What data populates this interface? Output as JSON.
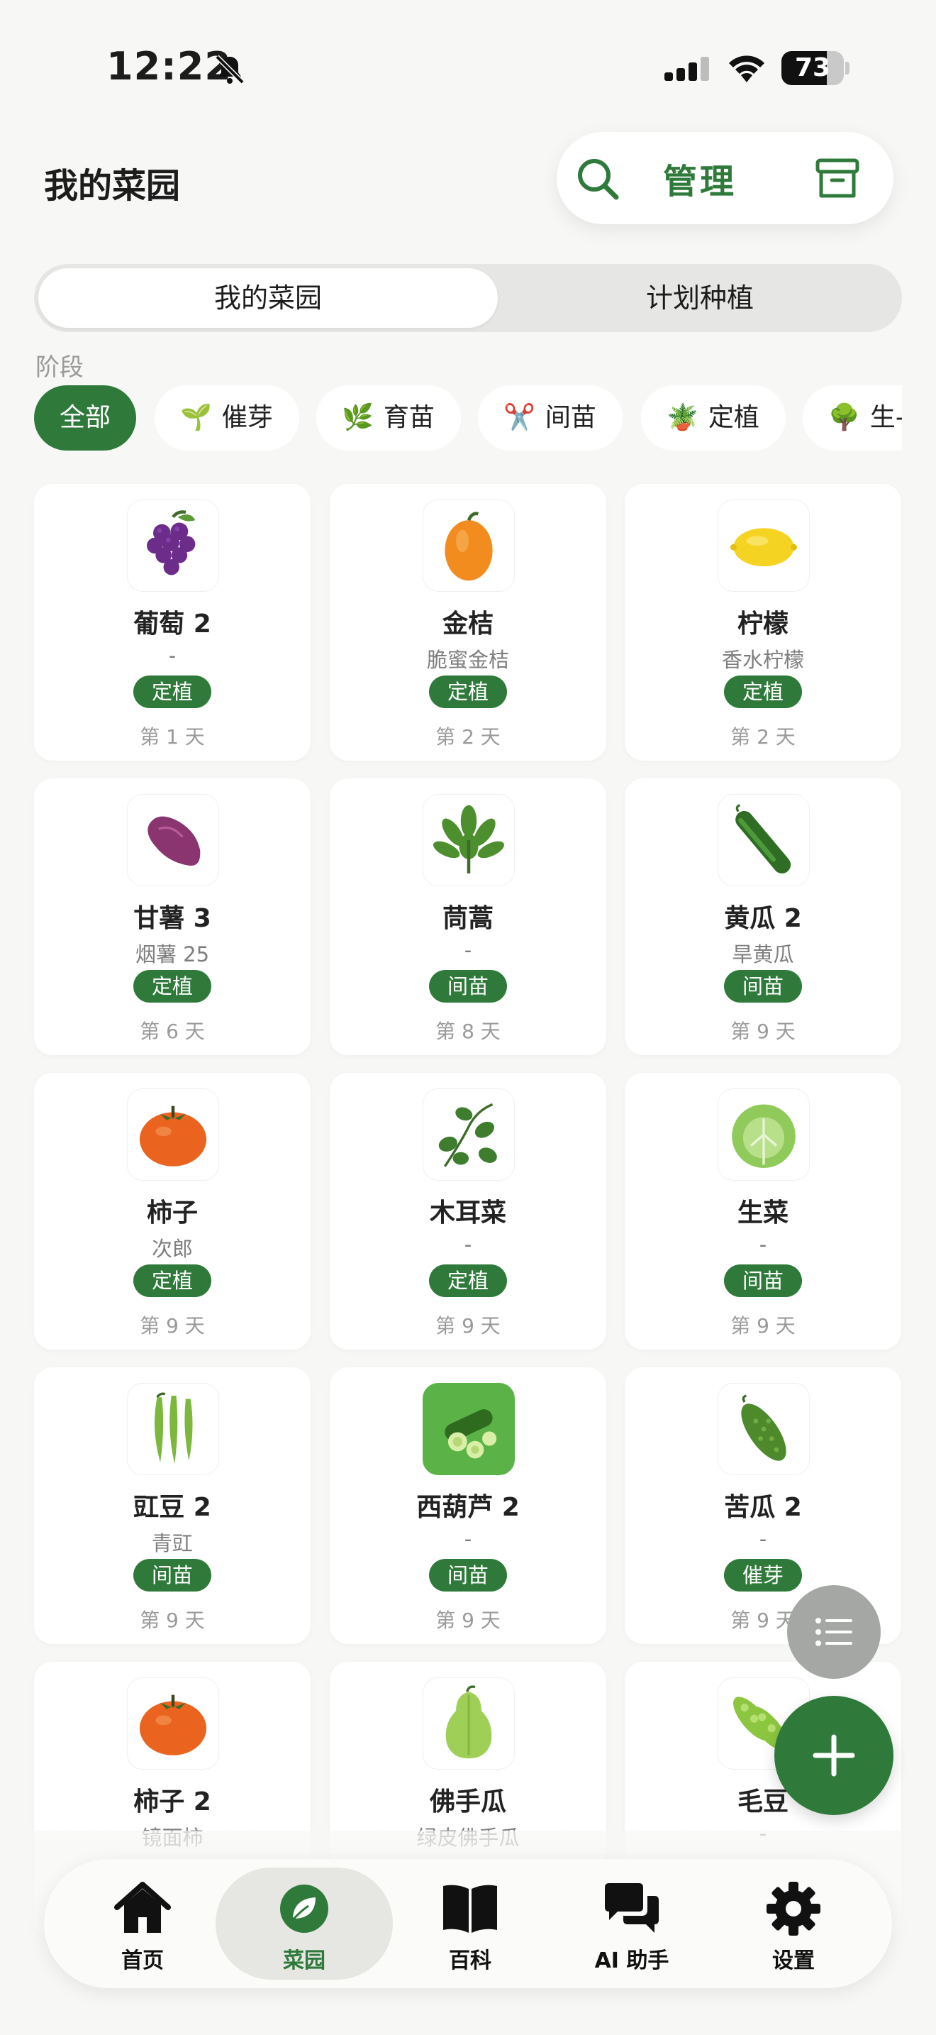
{
  "status": {
    "time": "12:22",
    "battery": "73",
    "battery_level": 0.73
  },
  "header": {
    "title": "我的菜园",
    "manage_label": "管理"
  },
  "segments": [
    {
      "label": "我的菜园"
    },
    {
      "label": "计划种植"
    }
  ],
  "stage_label": "阶段",
  "chips": [
    {
      "label": "全部",
      "icon": ""
    },
    {
      "label": "催芽",
      "icon": "🌱"
    },
    {
      "label": "育苗",
      "icon": "🌿"
    },
    {
      "label": "间苗",
      "icon": "✂️"
    },
    {
      "label": "定植",
      "icon": "🪴"
    },
    {
      "label": "生-",
      "icon": "🌳"
    }
  ],
  "plants": [
    {
      "name": "葡萄 2",
      "variety": "-",
      "stage": "定植",
      "days": "第 1 天",
      "icon": "grape-icon"
    },
    {
      "name": "金桔",
      "variety": "脆蜜金桔",
      "stage": "定植",
      "days": "第 2 天",
      "icon": "kumquat-icon"
    },
    {
      "name": "柠檬",
      "variety": "香水柠檬",
      "stage": "定植",
      "days": "第 2 天",
      "icon": "lemon-icon"
    },
    {
      "name": "甘薯 3",
      "variety": "烟薯 25",
      "stage": "定植",
      "days": "第 6 天",
      "icon": "sweet-potato-icon"
    },
    {
      "name": "茼蒿",
      "variety": "-",
      "stage": "间苗",
      "days": "第 8 天",
      "icon": "crown-daisy-icon"
    },
    {
      "name": "黄瓜 2",
      "variety": "旱黄瓜",
      "stage": "间苗",
      "days": "第 9 天",
      "icon": "cucumber-icon"
    },
    {
      "name": "柿子",
      "variety": "次郎",
      "stage": "定植",
      "days": "第 9 天",
      "icon": "persimmon-icon"
    },
    {
      "name": "木耳菜",
      "variety": "-",
      "stage": "定植",
      "days": "第 9 天",
      "icon": "malabar-spinach-icon"
    },
    {
      "name": "生菜",
      "variety": "-",
      "stage": "间苗",
      "days": "第 9 天",
      "icon": "lettuce-icon"
    },
    {
      "name": "豇豆 2",
      "variety": "青豇",
      "stage": "间苗",
      "days": "第 9 天",
      "icon": "cowpea-icon"
    },
    {
      "name": "西葫芦 2",
      "variety": "-",
      "stage": "间苗",
      "days": "第 9 天",
      "icon": "zucchini-icon"
    },
    {
      "name": "苦瓜 2",
      "variety": "-",
      "stage": "催芽",
      "days": "第 9 天",
      "icon": "bitter-melon-icon"
    },
    {
      "name": "柿子 2",
      "variety": "镜面柿",
      "stage": "",
      "days": "",
      "icon": "persimmon-icon"
    },
    {
      "name": "佛手瓜",
      "variety": "绿皮佛手瓜",
      "stage": "",
      "days": "",
      "icon": "chayote-icon"
    },
    {
      "name": "毛豆",
      "variety": "-",
      "stage": "",
      "days": "",
      "icon": "edamame-icon"
    }
  ],
  "tabs": [
    {
      "label": "首页",
      "icon": "home-icon"
    },
    {
      "label": "菜园",
      "icon": "leaf-icon"
    },
    {
      "label": "百科",
      "icon": "book-icon"
    },
    {
      "label": "AI 助手",
      "icon": "chat-icon"
    },
    {
      "label": "设置",
      "icon": "gear-icon"
    }
  ],
  "colors": {
    "accent": "#2f7a3b",
    "background": "#f7f7f5"
  }
}
